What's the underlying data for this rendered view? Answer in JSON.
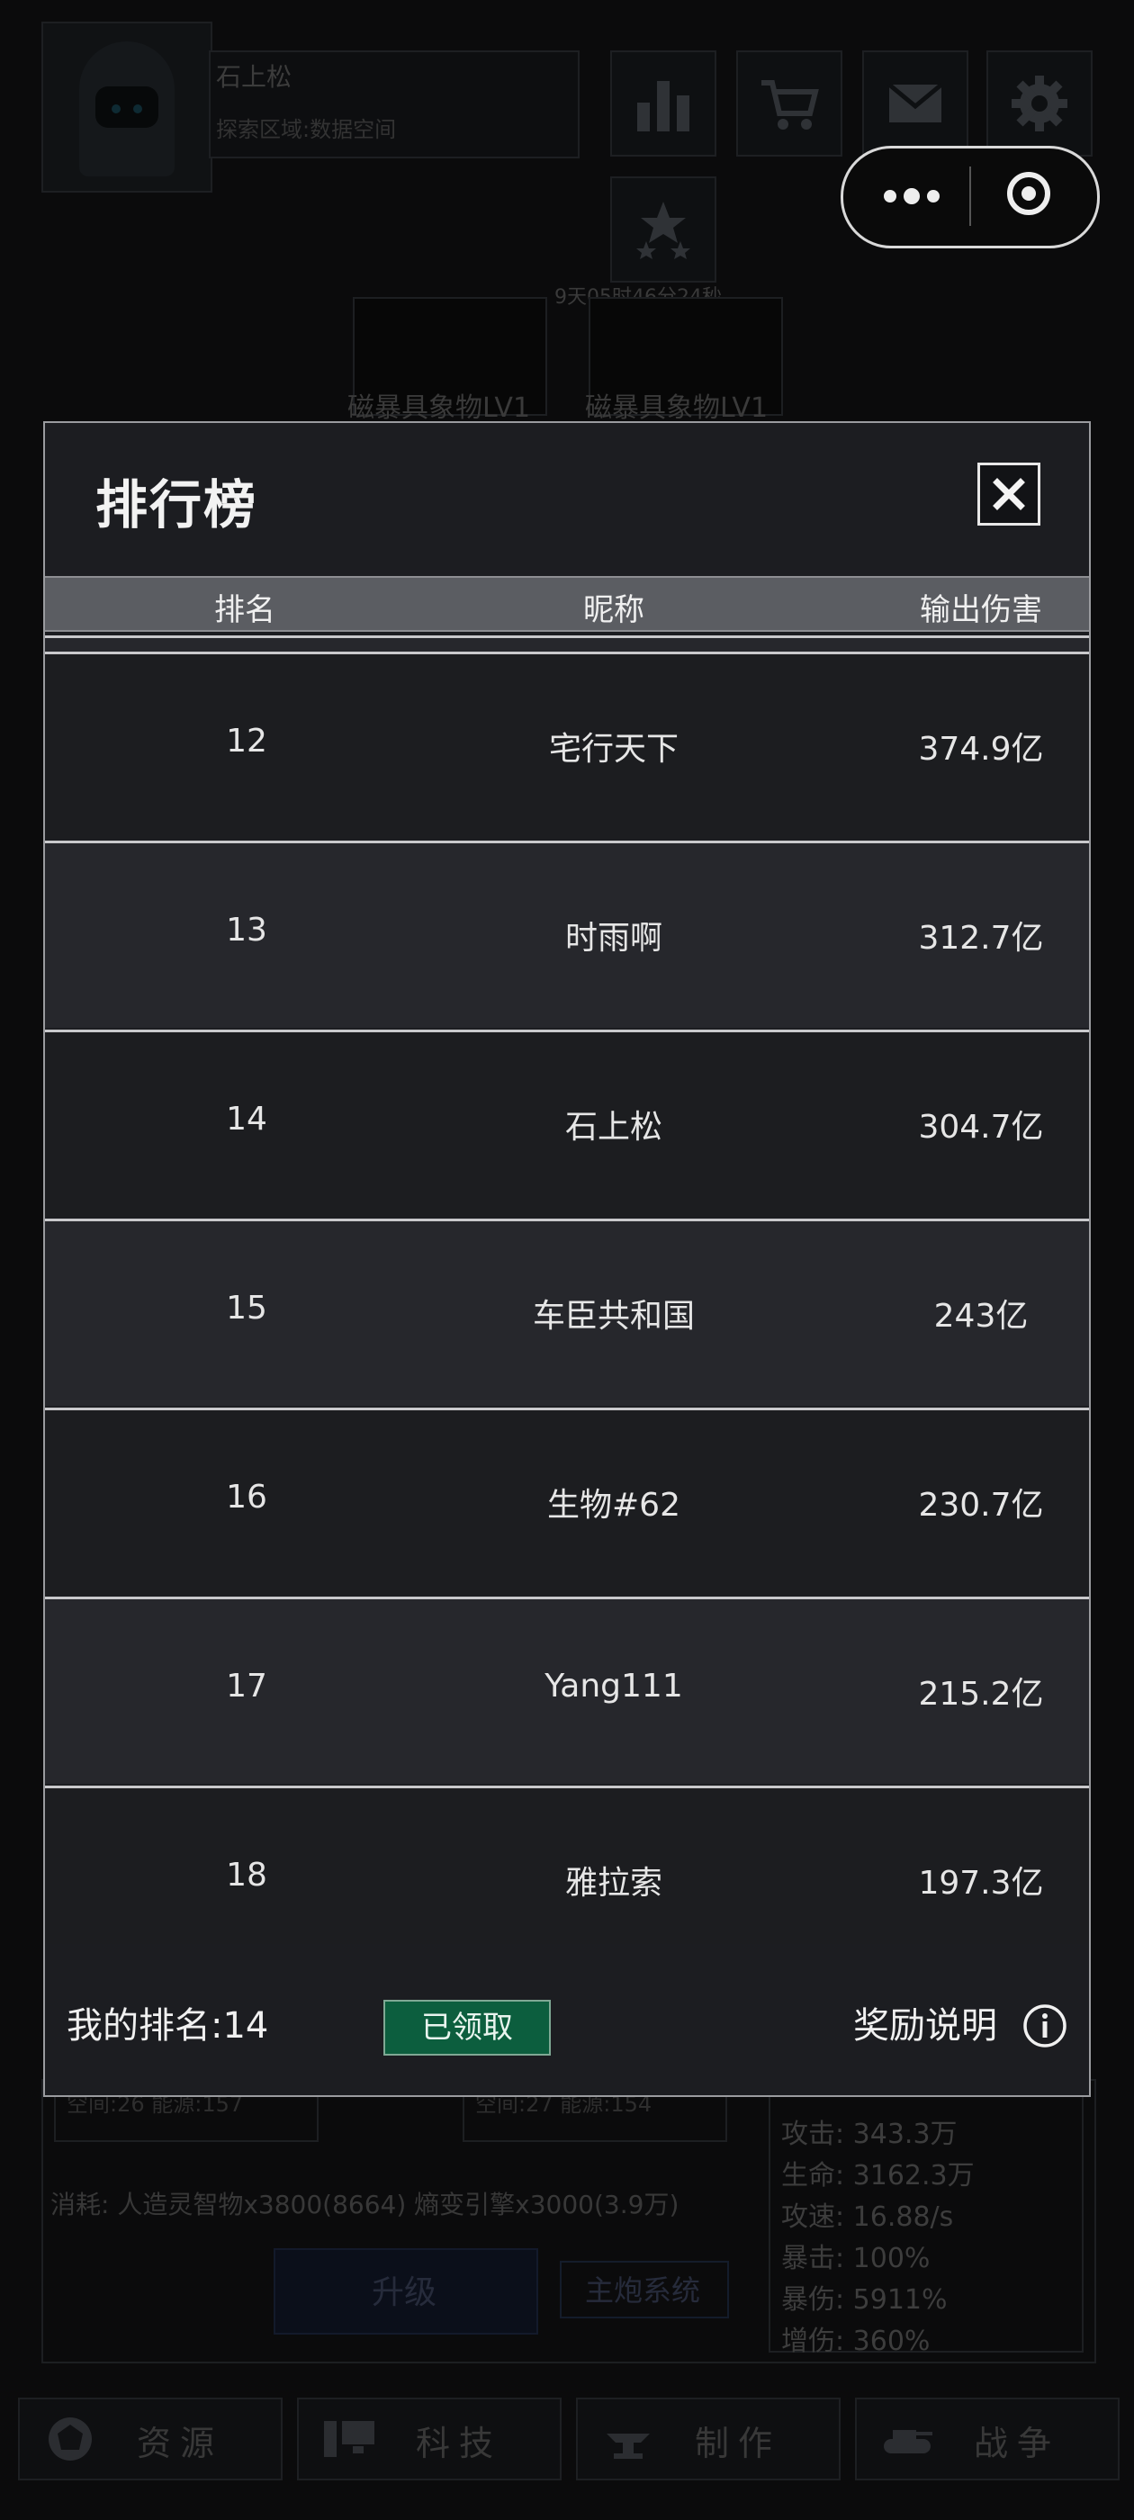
{
  "background": {
    "player_name": "石上松",
    "explore_area": "探索区域:数据空间",
    "timer": "9天05时46分24秒",
    "slots": [
      "磁暴具象物LV1",
      "磁暴具象物LV1"
    ],
    "space_left": "空间:26 能源:157",
    "space_right": "空间:27 能源:154",
    "cost": "消耗: 人造灵智物x3800(8664) 熵变引擎x3000(3.9万)",
    "upgrade_label": "升级",
    "cannon_label": "主炮系统",
    "stats": [
      "攻击: 343.3万",
      "生命: 3162.3万",
      "攻速: 16.88/s",
      "暴击: 100%",
      "暴伤: 5911%",
      "增伤: 360%"
    ],
    "nav": [
      "资源",
      "科技",
      "制作",
      "战争"
    ]
  },
  "modal": {
    "title": "排行榜",
    "columns": [
      "排名",
      "昵称",
      "输出伤害"
    ],
    "rows": [
      {
        "rank": "12",
        "name": "宅行天下",
        "damage": "374.9亿"
      },
      {
        "rank": "13",
        "name": "时雨啊",
        "damage": "312.7亿"
      },
      {
        "rank": "14",
        "name": "石上松",
        "damage": "304.7亿"
      },
      {
        "rank": "15",
        "name": "车臣共和国",
        "damage": "243亿"
      },
      {
        "rank": "16",
        "name": "生物#62",
        "damage": "230.7亿"
      },
      {
        "rank": "17",
        "name": "Yang111",
        "damage": "215.2亿"
      },
      {
        "rank": "18",
        "name": "雅拉索",
        "damage": "197.3亿"
      }
    ],
    "my_rank": "我的排名:14",
    "claimed_label": "已领取",
    "reward_label": "奖励说明"
  },
  "icons": {
    "close": "close-icon",
    "info": "info-icon",
    "chart": "bar-chart-icon",
    "cart": "cart-icon",
    "mail": "mail-icon",
    "settings": "gear-icon",
    "stars": "stars-icon"
  }
}
